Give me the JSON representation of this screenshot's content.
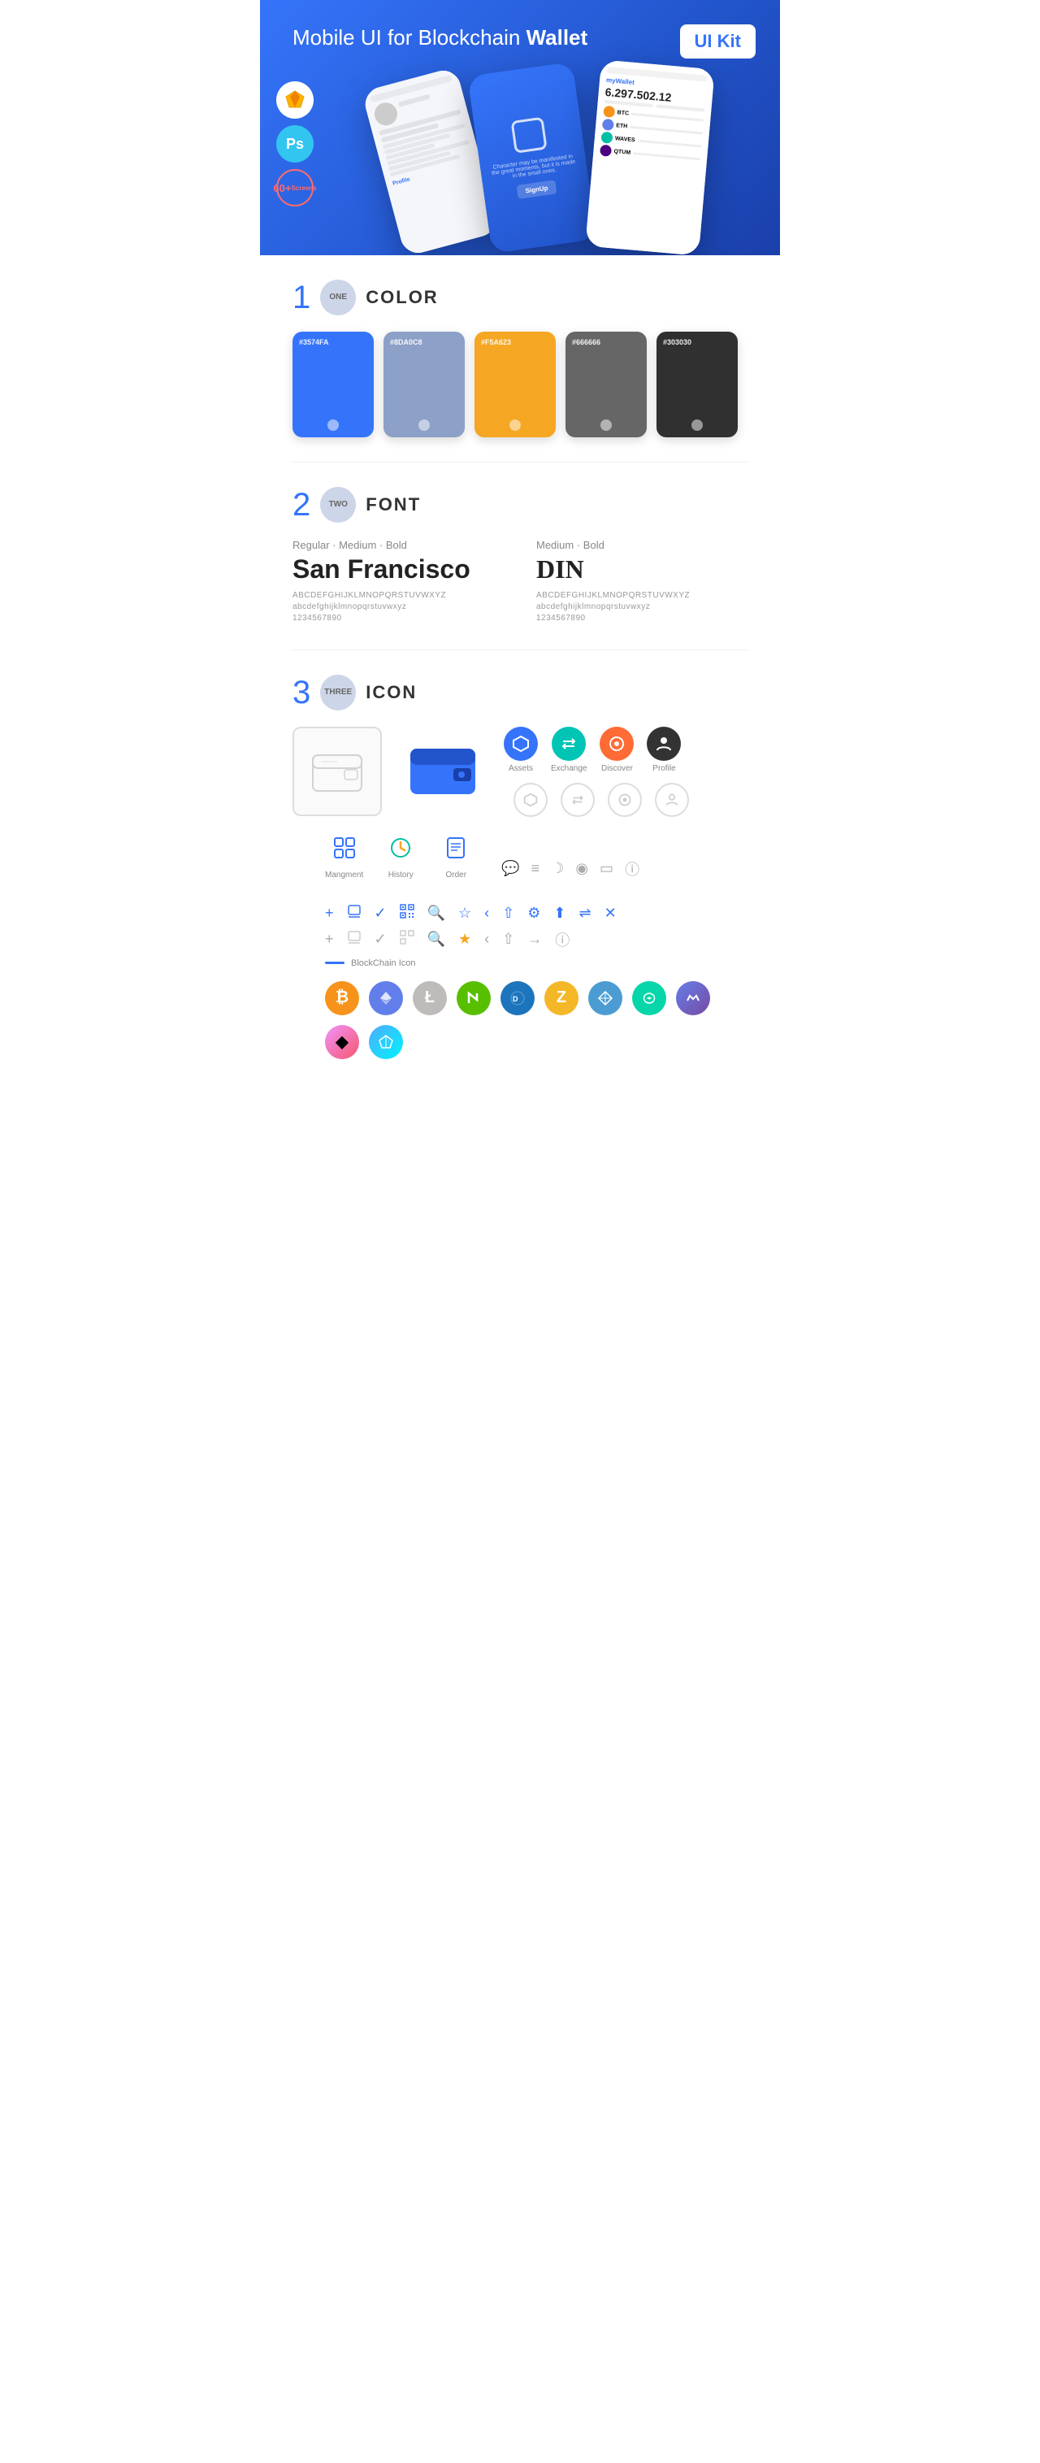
{
  "hero": {
    "title_regular": "Mobile UI for Blockchain ",
    "title_bold": "Wallet",
    "badge": "UI Kit",
    "badges": {
      "sketch": "S",
      "ps": "Ps",
      "screens_count": "60+",
      "screens_label": "Screens"
    }
  },
  "section1": {
    "number_big": "1",
    "number_word": "ONE",
    "title": "COLOR",
    "colors": [
      {
        "hex": "#3574FA",
        "code": "#3574FA"
      },
      {
        "hex": "#8DA0C8",
        "code": "#8DA0C8"
      },
      {
        "hex": "#F5A623",
        "code": "#F5A623"
      },
      {
        "hex": "#666666",
        "code": "#666666"
      },
      {
        "hex": "#303030",
        "code": "#303030"
      }
    ]
  },
  "section2": {
    "number_big": "2",
    "number_word": "TWO",
    "title": "FONT",
    "font1": {
      "style_label": "Regular · Medium · Bold",
      "name": "San Francisco",
      "uppercase": "ABCDEFGHIJKLMNOPQRSTUVWXYZ",
      "lowercase": "abcdefghijklmnopqrstuvwxyz",
      "numbers": "1234567890"
    },
    "font2": {
      "style_label": "Medium · Bold",
      "name": "DIN",
      "uppercase": "ABCDEFGHIJKLMNOPQRSTUVWXYZ",
      "lowercase": "abcdefghijklmnopqrstuvwxyz",
      "numbers": "1234567890"
    }
  },
  "section3": {
    "number_big": "3",
    "number_word": "THREE",
    "title": "ICON",
    "icon_labels": {
      "assets": "Assets",
      "exchange": "Exchange",
      "discover": "Discover",
      "profile": "Profile",
      "management": "Mangment",
      "history": "History",
      "order": "Order"
    },
    "blockchain_label": "BlockChain Icon",
    "crypto_icons": [
      "BTC",
      "ETH",
      "LTC",
      "NEO",
      "DASH",
      "ZEC",
      "GRID",
      "STEEM",
      "WAVES",
      "POLY",
      "EOS"
    ]
  }
}
